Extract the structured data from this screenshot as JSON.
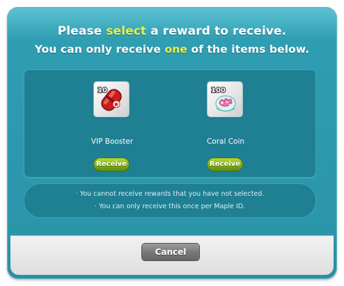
{
  "header": {
    "line1_pre": "Please ",
    "line1_highlight": "select",
    "line1_post": " a reward to receive.",
    "line2_pre": "You can only receive ",
    "line2_highlight": "one",
    "line2_post": " of the items below."
  },
  "rewards": [
    {
      "name": "VIP Booster",
      "icon": "vip-booster-icon",
      "badge": "10",
      "button_label": "Receive"
    },
    {
      "name": "Coral Coin",
      "icon": "coral-coin-icon",
      "badge": "100",
      "button_label": "Receive"
    }
  ],
  "notices": [
    "· You cannot receive rewards that you have not selected.",
    "· You can only receive this once per Maple ID."
  ],
  "footer": {
    "cancel_label": "Cancel"
  },
  "colors": {
    "panel_bg": "#2b95aa",
    "highlight": "#e8f24a",
    "receive_button": "#7fae1c",
    "cancel_button": "#777777"
  }
}
